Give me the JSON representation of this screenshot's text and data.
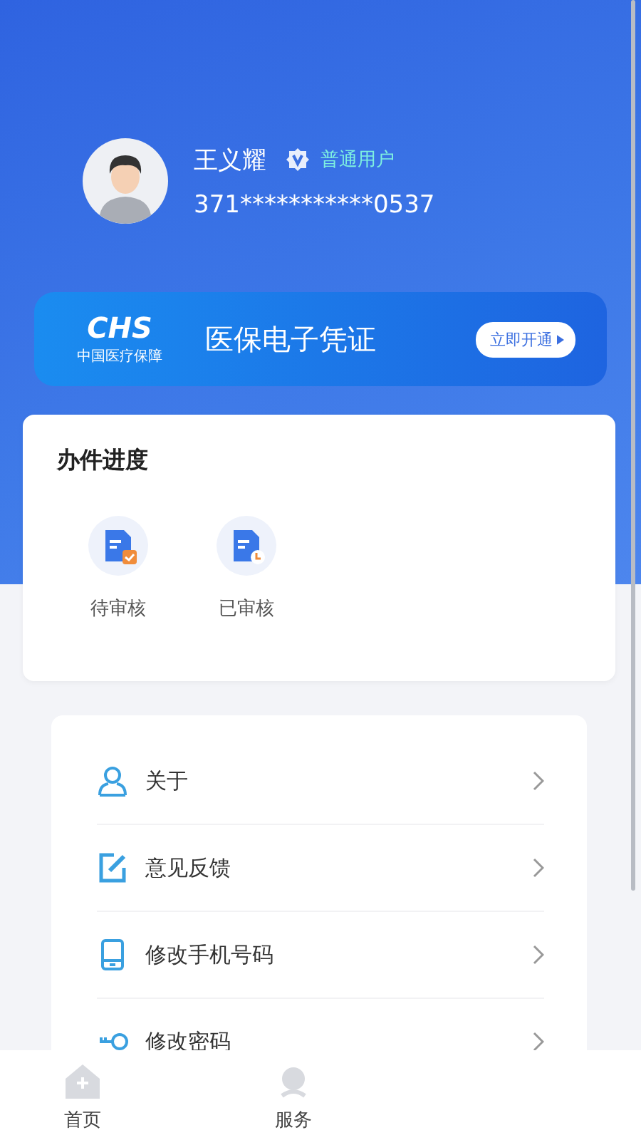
{
  "profile": {
    "name": "王义耀",
    "role": "普通用户",
    "id_number": "371***********0537"
  },
  "banner": {
    "logo": "CHS",
    "logo_caption": "中国医疗保障",
    "title": "医保电子凭证",
    "button": "立即开通"
  },
  "progress": {
    "title": "办件进度",
    "items": [
      {
        "label": "待审核",
        "kind": "pending"
      },
      {
        "label": "已审核",
        "kind": "done"
      }
    ]
  },
  "menu": [
    {
      "label": "关于",
      "kind": "person"
    },
    {
      "label": "意见反馈",
      "kind": "edit"
    },
    {
      "label": "修改手机号码",
      "kind": "phone"
    },
    {
      "label": "修改密码",
      "kind": "key"
    }
  ],
  "tabbar": [
    {
      "label": "首页",
      "kind": "home",
      "selected": false
    },
    {
      "label": "服务",
      "kind": "service",
      "selected": false
    }
  ]
}
